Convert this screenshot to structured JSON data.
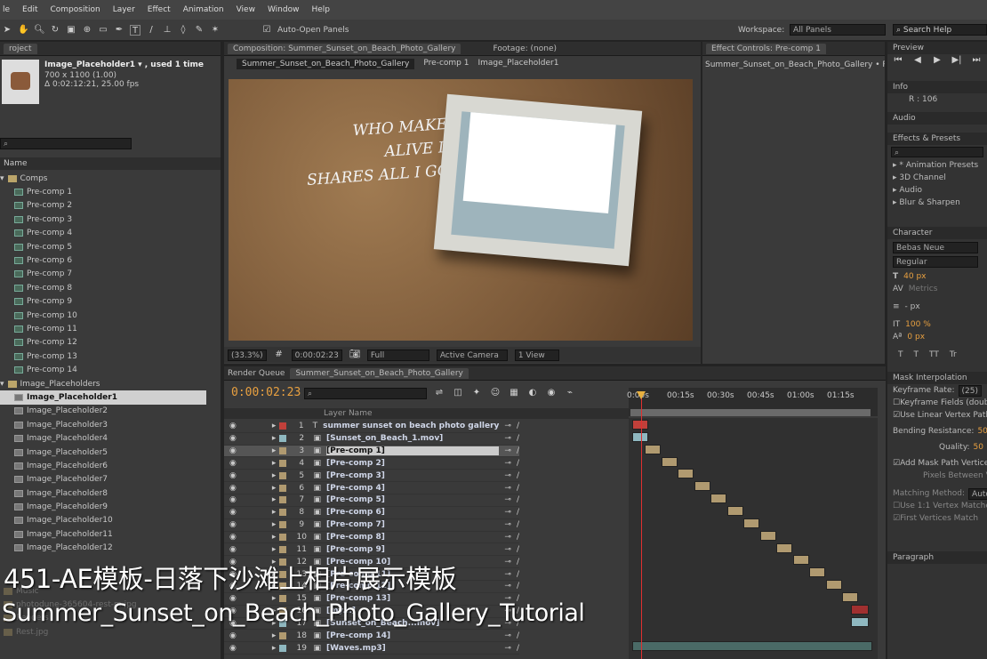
{
  "menu": [
    "le",
    "Edit",
    "Composition",
    "Layer",
    "Effect",
    "Animation",
    "View",
    "Window",
    "Help"
  ],
  "toolbar": {
    "auto_open": "Auto-Open Panels",
    "workspace_label": "Workspace:",
    "workspace_value": "All Panels",
    "search_help": "Search Help"
  },
  "project": {
    "tab": "roject",
    "item_name": "Image_Placeholder1 ▾ , used 1 time",
    "item_size": "700 x 1100 (1.00)",
    "item_dur": "Δ 0:02:12:21, 25.00 fps",
    "col_name": "Name",
    "tree": [
      {
        "kind": "folder",
        "label": "Comps"
      },
      {
        "kind": "comp",
        "label": "Pre-comp 1"
      },
      {
        "kind": "comp",
        "label": "Pre-comp 2"
      },
      {
        "kind": "comp",
        "label": "Pre-comp 3"
      },
      {
        "kind": "comp",
        "label": "Pre-comp 4"
      },
      {
        "kind": "comp",
        "label": "Pre-comp 5"
      },
      {
        "kind": "comp",
        "label": "Pre-comp 6"
      },
      {
        "kind": "comp",
        "label": "Pre-comp 7"
      },
      {
        "kind": "comp",
        "label": "Pre-comp 8"
      },
      {
        "kind": "comp",
        "label": "Pre-comp 9"
      },
      {
        "kind": "comp",
        "label": "Pre-comp 10"
      },
      {
        "kind": "comp",
        "label": "Pre-comp 11"
      },
      {
        "kind": "comp",
        "label": "Pre-comp 12"
      },
      {
        "kind": "comp",
        "label": "Pre-comp 13"
      },
      {
        "kind": "comp",
        "label": "Pre-comp 14"
      },
      {
        "kind": "folder",
        "label": "Image_Placeholders"
      },
      {
        "kind": "img",
        "label": "Image_Placeholder1",
        "selected": true
      },
      {
        "kind": "img",
        "label": "Image_Placeholder2"
      },
      {
        "kind": "img",
        "label": "Image_Placeholder3"
      },
      {
        "kind": "img",
        "label": "Image_Placeholder4"
      },
      {
        "kind": "img",
        "label": "Image_Placeholder5"
      },
      {
        "kind": "img",
        "label": "Image_Placeholder6"
      },
      {
        "kind": "img",
        "label": "Image_Placeholder7"
      },
      {
        "kind": "img",
        "label": "Image_Placeholder8"
      },
      {
        "kind": "img",
        "label": "Image_Placeholder9"
      },
      {
        "kind": "img",
        "label": "Image_Placeholder10"
      },
      {
        "kind": "img",
        "label": "Image_Placeholder11"
      },
      {
        "kind": "img",
        "label": "Image_Placeholder12"
      }
    ],
    "footer": [
      "Music",
      "photodune-365604-rest-m.jpg",
      "Renders",
      "Rest.jpg"
    ]
  },
  "comp": {
    "tab": "Composition: Summer_Sunset_on_Beach_Photo_Gallery",
    "footage_tab": "Footage: (none)",
    "crumbs": [
      "Summer_Sunset_on_Beach_Photo_Gallery",
      "Pre-comp 1",
      "Image_Placeholder1"
    ],
    "viewer_text": [
      "WHO MAKES ME FEEL",
      "ALIVE INSIDE AND",
      "SHARES ALL I GO THROUGH"
    ],
    "zoom": "(33.3%)",
    "time": "0:00:02:23",
    "res": "Full",
    "camera": "Active Camera",
    "view": "1 View"
  },
  "effect": {
    "tab": "Effect Controls: Pre-comp 1",
    "line": "Summer_Sunset_on_Beach_Photo_Gallery • Pre-"
  },
  "right": {
    "preview": "Preview",
    "info": "Info",
    "info_r": "R : 106",
    "audio": "Audio",
    "effects": "Effects & Presets",
    "effects_items": [
      "* Animation Presets",
      "3D Channel",
      "Audio",
      "Blur & Sharpen"
    ],
    "character": "Character",
    "font": "Bebas Neue",
    "style": "Regular",
    "size": "40 px",
    "metrics": "Metrics",
    "px": "- px",
    "scale_v": "100 %",
    "baseline": "0 px",
    "tt": [
      "T",
      "T",
      "TT",
      "Tr"
    ],
    "mask": "Mask Interpolation",
    "kf_rate": "Keyframe Rate:",
    "kf_val": "(25)",
    "kf_fields": "Keyframe Fields (doub",
    "linear": "Use Linear Vertex Paths",
    "bend": "Bending Resistance:",
    "bend_v": "50",
    "quality": "Quality:",
    "quality_v": "50",
    "add_mask": "Add Mask Path Vertices",
    "pixels": "Pixels Between V",
    "matching": "Matching Method:",
    "matching_v": "Auto",
    "use11": "Use 1:1 Vertex Matches",
    "first": "First Vertices Match",
    "paragraph": "Paragraph"
  },
  "timeline": {
    "tab1": "Render Queue",
    "tab2": "Summer_Sunset_on_Beach_Photo_Gallery",
    "time": "0:00:02:23",
    "col_layer": "Layer Name",
    "ticks": [
      "0:00s",
      "00:15s",
      "00:30s",
      "00:45s",
      "01:00s",
      "01:15s"
    ],
    "layers": [
      {
        "n": "1",
        "name": "summer sunset on beach photo gallery",
        "type": "T",
        "color": "#c0403a"
      },
      {
        "n": "2",
        "name": "[Sunset_on_Beach_1.mov]",
        "type": "mov",
        "color": "#8fb8c0"
      },
      {
        "n": "3",
        "name": "[Pre-comp 1]",
        "type": "comp",
        "color": "#b09a70",
        "selected": true
      },
      {
        "n": "4",
        "name": "[Pre-comp 2]",
        "type": "comp",
        "color": "#b09a70"
      },
      {
        "n": "5",
        "name": "[Pre-comp 3]",
        "type": "comp",
        "color": "#b09a70"
      },
      {
        "n": "6",
        "name": "[Pre-comp 4]",
        "type": "comp",
        "color": "#b09a70"
      },
      {
        "n": "7",
        "name": "[Pre-comp 5]",
        "type": "comp",
        "color": "#b09a70"
      },
      {
        "n": "8",
        "name": "[Pre-comp 6]",
        "type": "comp",
        "color": "#b09a70"
      },
      {
        "n": "9",
        "name": "[Pre-comp 7]",
        "type": "comp",
        "color": "#b09a70"
      },
      {
        "n": "10",
        "name": "[Pre-comp 8]",
        "type": "comp",
        "color": "#b09a70"
      },
      {
        "n": "11",
        "name": "[Pre-comp 9]",
        "type": "comp",
        "color": "#b09a70"
      },
      {
        "n": "12",
        "name": "[Pre-comp 10]",
        "type": "comp",
        "color": "#b09a70"
      },
      {
        "n": "13",
        "name": "[Pre-comp 11]",
        "type": "comp",
        "color": "#b09a70"
      },
      {
        "n": "14",
        "name": "[Pre-comp 12]",
        "type": "comp",
        "color": "#b09a70"
      },
      {
        "n": "15",
        "name": "[Pre-comp 13]",
        "type": "comp",
        "color": "#b09a70"
      },
      {
        "n": "16",
        "name": "[my...]",
        "type": "comp",
        "color": "#b09a70"
      },
      {
        "n": "17",
        "name": "[Sunset_on_Beach...mov]",
        "type": "mov",
        "color": "#8fb8c0"
      },
      {
        "n": "18",
        "name": "[Pre-comp 14]",
        "type": "comp",
        "color": "#b09a70"
      },
      {
        "n": "19",
        "name": "[Waves.mp3]",
        "type": "audio",
        "color": "#8fb8c0"
      }
    ]
  },
  "captions": {
    "line1": "451-AE模板-日落下沙滩上相片展示模板",
    "line2": "Summer_Sunset_on_Beach_Photo_Gallery_Tutorial"
  }
}
